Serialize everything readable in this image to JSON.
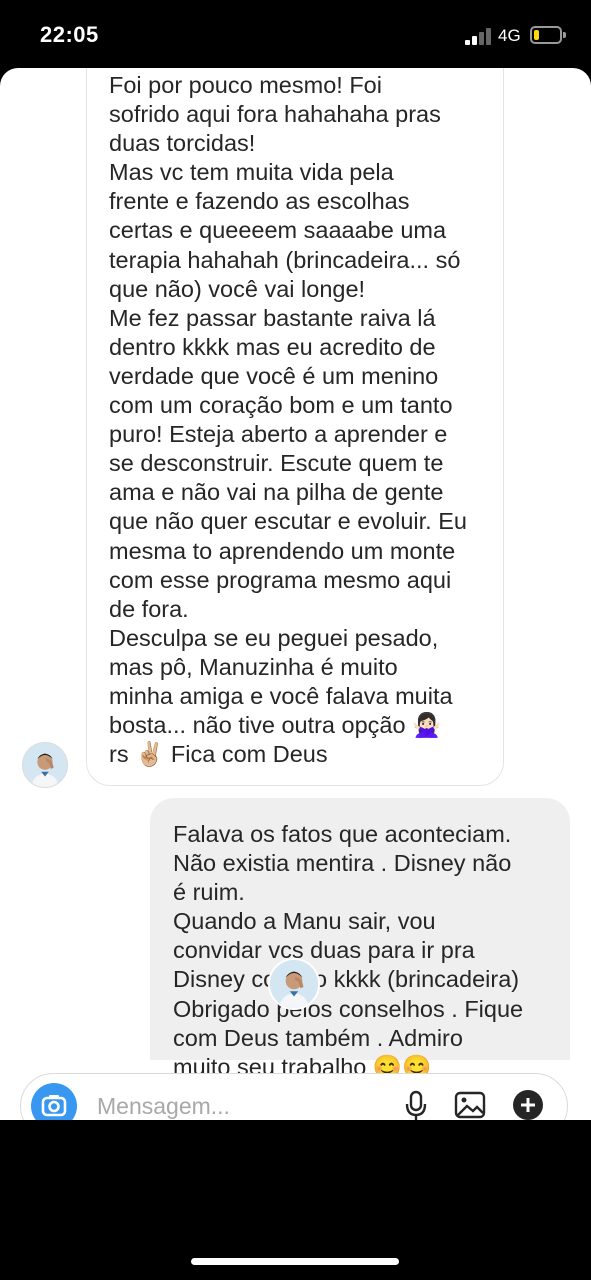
{
  "status_bar": {
    "time": "22:05",
    "network": "4G",
    "battery_level": 0.22,
    "battery_color": "#ffd60a"
  },
  "messages": {
    "received": "Foi por pouco mesmo! Foi\nsofrido aqui fora hahahaha pras\nduas torcidas!\nMas vc tem muita vida pela\nfrente e fazendo as escolhas\ncertas e queeeem saaaabe uma\nterapia hahahah (brincadeira... só\nque não) você vai longe!\nMe fez passar bastante raiva lá\ndentro kkkk mas eu acredito de\nverdade que você é um menino\ncom um coração bom e um tanto\npuro! Esteja aberto a aprender e\nse desconstruir. Escute quem te\nama e não vai na pilha de gente\nque não quer escutar e evoluir. Eu\nmesma to aprendendo um monte\ncom esse programa mesmo aqui\nde fora.\nDesculpa se eu peguei pesado,\nmas pô, Manuzinha é muito\nminha amiga e você falava muita\nbosta... não tive outra opção 🙅🏻‍♀️\nrs ✌🏼 Fica com Deus",
    "sent": "Falava os fatos que aconteciam.\nNão existia mentira .  Disney não\né  ruim.\nQuando a Manu sair, vou\nconvidar vcs duas para ir pra\nDisney comigo kkkk (brincadeira)\nObrigado pelos conselhos . Fique\ncom Deus também . Admiro\nmuito seu trabalho 😊😊"
  },
  "composer": {
    "placeholder": "Mensagem...",
    "icons": [
      "camera-icon",
      "microphone-icon",
      "gallery-icon",
      "plus-icon"
    ],
    "camera_button_color": "#3897f0"
  }
}
